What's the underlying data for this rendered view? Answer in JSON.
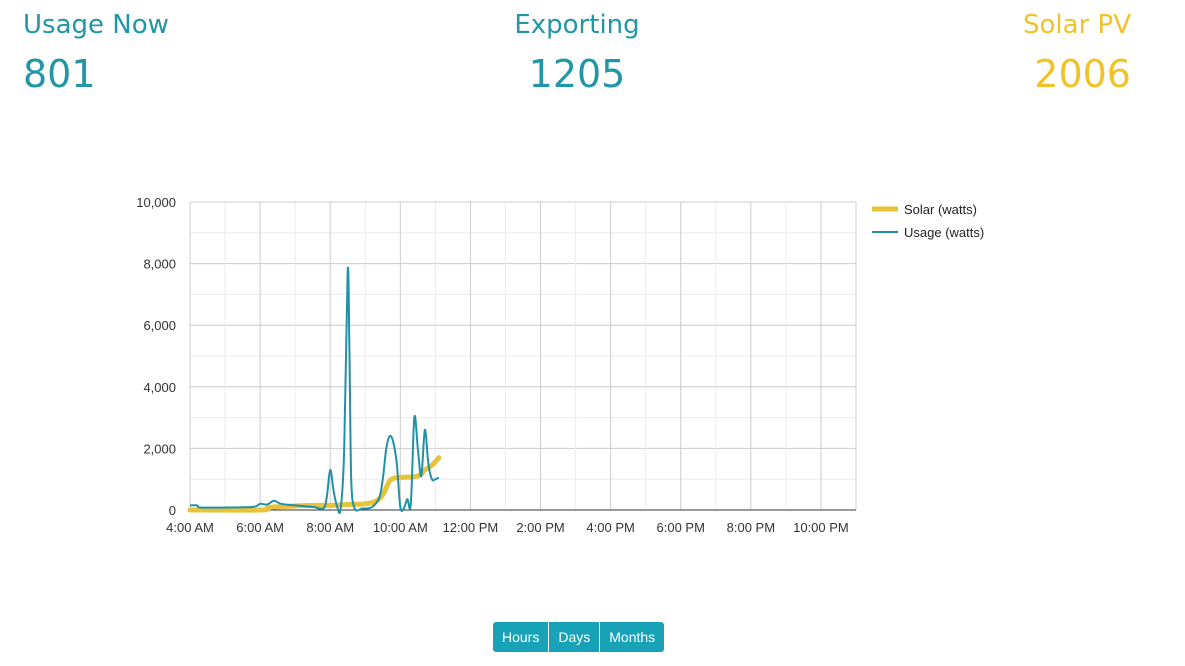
{
  "stats": {
    "usage": {
      "label": "Usage Now",
      "value": "801"
    },
    "exporting": {
      "label": "Exporting",
      "value": "1205"
    },
    "solar": {
      "label": "Solar PV",
      "value": "2006"
    }
  },
  "colors": {
    "solar": "#e8c33a",
    "usage": "#2190a8",
    "teal_text": "#2196a6",
    "yellow_text": "#f2c229",
    "button_bg": "#17a2b8"
  },
  "buttons": {
    "hours": "Hours",
    "days": "Days",
    "months": "Months"
  },
  "chart_data": {
    "type": "line",
    "x_ticks": [
      "4:00 AM",
      "6:00 AM",
      "8:00 AM",
      "10:00 AM",
      "12:00 PM",
      "2:00 PM",
      "4:00 PM",
      "6:00 PM",
      "8:00 PM",
      "10:00 PM"
    ],
    "x_range_hours": [
      4,
      23
    ],
    "ylim": [
      0,
      10000
    ],
    "y_ticks": [
      "0",
      "2,000",
      "4,000",
      "6,000",
      "8,000",
      "10,000"
    ],
    "grid": true,
    "legend_position": "right",
    "series": [
      {
        "name": "Solar (watts)",
        "color": "#e8c33a",
        "x_hours": [
          4.0,
          6.0,
          6.2,
          6.4,
          7.0,
          7.5,
          8.0,
          8.5,
          9.0,
          9.3,
          9.5,
          9.7,
          9.9,
          10.0,
          10.5,
          10.7,
          10.9,
          11.1
        ],
        "values": [
          0,
          0,
          60,
          100,
          130,
          150,
          150,
          180,
          200,
          280,
          500,
          950,
          1050,
          1060,
          1100,
          1300,
          1450,
          1700
        ]
      },
      {
        "name": "Usage (watts)",
        "color": "#2190a8",
        "x_hours": [
          4.0,
          4.2,
          4.3,
          5.0,
          5.8,
          6.0,
          6.2,
          6.4,
          6.6,
          7.0,
          7.5,
          7.8,
          7.9,
          8.0,
          8.1,
          8.2,
          8.3,
          8.4,
          8.5,
          8.55,
          8.6,
          8.7,
          8.9,
          9.0,
          9.2,
          9.4,
          9.5,
          9.6,
          9.7,
          9.8,
          9.9,
          10.0,
          10.1,
          10.2,
          10.3,
          10.4,
          10.5,
          10.6,
          10.7,
          10.8,
          10.9,
          11.0,
          11.1
        ],
        "values": [
          150,
          150,
          80,
          80,
          100,
          200,
          180,
          300,
          200,
          150,
          100,
          50,
          400,
          1300,
          600,
          100,
          50,
          2000,
          7800,
          5000,
          1000,
          50,
          50,
          50,
          100,
          400,
          1000,
          2000,
          2400,
          2200,
          1500,
          100,
          50,
          350,
          200,
          3000,
          2000,
          1100,
          2600,
          1500,
          1000,
          1000,
          1050
        ]
      }
    ]
  }
}
